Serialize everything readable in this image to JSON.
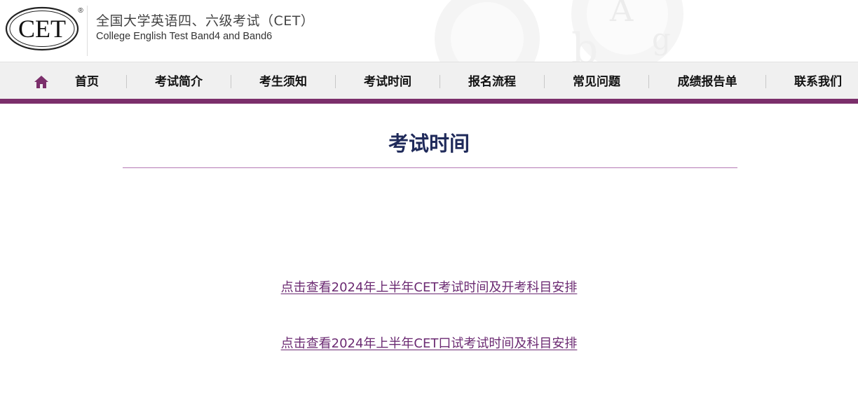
{
  "header": {
    "logo_text": "CET",
    "logo_mark": "®",
    "site_title_cn": "全国大学英语四、六级考试（CET）",
    "site_title_en": "College English Test Band4 and Band6"
  },
  "nav": {
    "home_icon": "home-icon",
    "items": [
      {
        "label": "首页"
      },
      {
        "label": "考试简介"
      },
      {
        "label": "考生须知"
      },
      {
        "label": "考试时间"
      },
      {
        "label": "报名流程"
      },
      {
        "label": "常见问题"
      },
      {
        "label": "成绩报告单"
      },
      {
        "label": "联系我们"
      }
    ]
  },
  "main": {
    "title": "考试时间",
    "links": [
      {
        "text": "点击查看2024年上半年CET考试时间及开考科目安排"
      },
      {
        "text": "点击查看2024年上半年CET口试考试时间及科目安排"
      }
    ]
  },
  "colors": {
    "brand_purple": "#7b2f6b",
    "title_navy": "#1f2a5a",
    "link_purple": "#6b2a72",
    "nav_bg": "#f0f0f0"
  }
}
